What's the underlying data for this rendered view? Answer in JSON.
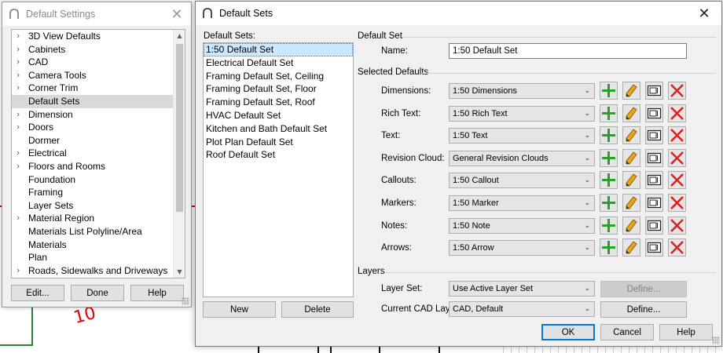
{
  "background": {
    "partial_label": "10"
  },
  "settings_window": {
    "title": "Default Settings",
    "close_glyph": "✕",
    "tree_items": [
      {
        "label": "3D View Defaults",
        "expandable": true
      },
      {
        "label": "Cabinets",
        "expandable": true
      },
      {
        "label": "CAD",
        "expandable": true
      },
      {
        "label": "Camera Tools",
        "expandable": true
      },
      {
        "label": "Corner Trim",
        "expandable": true
      },
      {
        "label": "Default Sets",
        "expandable": false,
        "selected": true
      },
      {
        "label": "Dimension",
        "expandable": true
      },
      {
        "label": "Doors",
        "expandable": true
      },
      {
        "label": "Dormer",
        "expandable": false
      },
      {
        "label": "Electrical",
        "expandable": true
      },
      {
        "label": "Floors and Rooms",
        "expandable": true
      },
      {
        "label": "Foundation",
        "expandable": false
      },
      {
        "label": "Framing",
        "expandable": false
      },
      {
        "label": "Layer Sets",
        "expandable": false
      },
      {
        "label": "Material Region",
        "expandable": true
      },
      {
        "label": "Materials List Polyline/Area",
        "expandable": false
      },
      {
        "label": "Materials",
        "expandable": false
      },
      {
        "label": "Plan",
        "expandable": false
      },
      {
        "label": "Roads, Sidewalks and Driveways",
        "expandable": true
      }
    ],
    "buttons": {
      "edit": "Edit...",
      "done": "Done",
      "help": "Help"
    }
  },
  "sets_window": {
    "title": "Default Sets",
    "close_glyph": "✕",
    "list_label": "Default Sets:",
    "sets": [
      {
        "label": "1:50 Default Set",
        "selected": true
      },
      {
        "label": "Electrical Default Set"
      },
      {
        "label": "Framing Default Set, Ceiling"
      },
      {
        "label": "Framing Default Set, Floor"
      },
      {
        "label": "Framing Default Set, Roof"
      },
      {
        "label": "HVAC Default Set"
      },
      {
        "label": "Kitchen and Bath Default Set"
      },
      {
        "label": "Plot Plan Default Set"
      },
      {
        "label": "Roof Default Set"
      }
    ],
    "new_button": "New",
    "delete_button": "Delete",
    "default_set_group": "Default Set",
    "name_label": "Name:",
    "name_value": "1:50 Default Set",
    "selected_defaults_group": "Selected Defaults",
    "defaults": [
      {
        "label": "Dimensions:",
        "value": "1:50 Dimensions"
      },
      {
        "label": "Rich Text:",
        "value": "1:50 Rich Text"
      },
      {
        "label": "Text:",
        "value": "1:50 Text"
      },
      {
        "label": "Revision Cloud:",
        "value": "General Revision Clouds"
      },
      {
        "label": "Callouts:",
        "value": "1:50 Callout"
      },
      {
        "label": "Markers:",
        "value": "1:50 Marker"
      },
      {
        "label": "Notes:",
        "value": "1:50 Note"
      },
      {
        "label": "Arrows:",
        "value": "1:50 Arrow"
      }
    ],
    "layers_group": "Layers",
    "layer_set_label": "Layer Set:",
    "layer_set_value": "Use Active Layer Set",
    "layer_define": "Define...",
    "cad_layer_label": "Current CAD Layer:",
    "cad_layer_value": "CAD,  Default",
    "cad_define": "Define...",
    "ok": "OK",
    "cancel": "Cancel",
    "help": "Help"
  },
  "colors": {
    "add_green": "#2aa12a",
    "delete_red": "#e02020",
    "edit_pencil": "#e8a317",
    "selection_blue": "#cce8ff",
    "focus_blue": "#0078d7"
  }
}
